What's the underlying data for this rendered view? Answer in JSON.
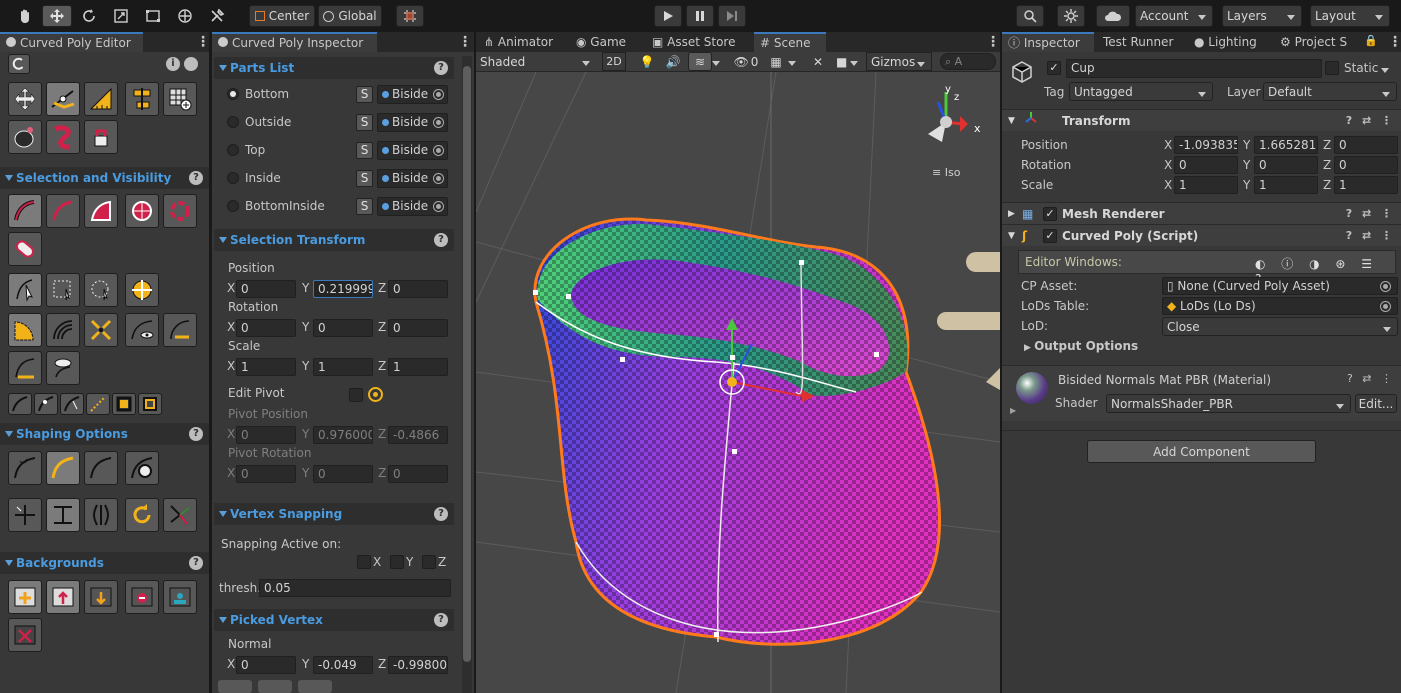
{
  "toolbar": {
    "pivot_mode": "Center",
    "pivot_rotation": "Global",
    "account": "Account",
    "layers": "Layers",
    "layout": "Layout"
  },
  "curved_poly_editor": {
    "tab_title": "Curved Poly Editor",
    "sections": {
      "selection": "Selection and Visibility",
      "shaping": "Shaping Options",
      "backgrounds": "Backgrounds"
    }
  },
  "inspector_panel": {
    "tab_title": "Curved Poly Inspector",
    "parts_list": {
      "title": "Parts List",
      "items": [
        {
          "name": "Bottom",
          "selected": true,
          "s": "S",
          "mode": "Biside"
        },
        {
          "name": "Outside",
          "selected": false,
          "s": "S",
          "mode": "Biside"
        },
        {
          "name": "Top",
          "selected": false,
          "s": "S",
          "mode": "Biside"
        },
        {
          "name": "Inside",
          "selected": false,
          "s": "S",
          "mode": "Biside"
        },
        {
          "name": "BottomInside",
          "selected": false,
          "s": "S",
          "mode": "Biside"
        }
      ]
    },
    "selection_transform": {
      "title": "Selection Transform",
      "position_label": "Position",
      "position": {
        "x": "0",
        "y": "0.219999",
        "z": "0"
      },
      "rotation_label": "Rotation",
      "rotation": {
        "x": "0",
        "y": "0",
        "z": "0"
      },
      "scale_label": "Scale",
      "scale": {
        "x": "1",
        "y": "1",
        "z": "1"
      },
      "edit_pivot_label": "Edit Pivot",
      "pivot_position_label": "Pivot Position",
      "pivot_position": {
        "x": "0",
        "y": "0.976000",
        "z": "-0.4866"
      },
      "pivot_rotation_label": "Pivot Rotation",
      "pivot_rotation": {
        "x": "0",
        "y": "0",
        "z": "0"
      }
    },
    "vertex_snapping": {
      "title": "Vertex Snapping",
      "active_label": "Snapping Active on:",
      "axes": [
        "X",
        "Y",
        "Z"
      ],
      "thresh_label": "thresh.",
      "thresh": "0.05"
    },
    "picked_vertex": {
      "title": "Picked Vertex",
      "normal_label": "Normal",
      "normal": {
        "x": "0",
        "y": "-0.049",
        "z": "-0.99800"
      }
    }
  },
  "scene_tabs": [
    "Animator",
    "Game",
    "Asset Store",
    "Scene"
  ],
  "scene_toolbar": {
    "shading": "Shaded",
    "mode_2d": "2D",
    "hidden_count": "0",
    "gizmos": "Gizmos",
    "search_placeholder": "A"
  },
  "scene": {
    "projection": "Iso",
    "axis_x": "x",
    "axis_y": "y",
    "axis_z": "z"
  },
  "inspector": {
    "tabs": [
      "Inspector",
      "Test Runner",
      "Lighting",
      "Project S"
    ],
    "object_name": "Cup",
    "static_label": "Static",
    "tag_label": "Tag",
    "tag": "Untagged",
    "layer_label": "Layer",
    "layer": "Default",
    "transform": {
      "title": "Transform",
      "position_label": "Position",
      "position": {
        "x": "-1.093835",
        "y": "1.665281",
        "z": "0"
      },
      "rotation_label": "Rotation",
      "rotation": {
        "x": "0",
        "y": "0",
        "z": "0"
      },
      "scale_label": "Scale",
      "scale": {
        "x": "1",
        "y": "1",
        "z": "1"
      }
    },
    "mesh_renderer": "Mesh Renderer",
    "curved_poly_script": {
      "title": "Curved Poly (Script)",
      "editor_windows": "Editor Windows:",
      "cp_asset_label": "CP Asset:",
      "cp_asset": "None (Curved Poly Asset)",
      "lods_table_label": "LoDs Table:",
      "lods_table": "LoDs (Lo Ds)",
      "lod_label": "LoD:",
      "lod": "Close",
      "output_options": "Output Options"
    },
    "material": {
      "title": "Bisided Normals Mat PBR (Material)",
      "shader_label": "Shader",
      "shader": "NormalsShader_PBR",
      "edit": "Edit..."
    },
    "add_component": "Add Component"
  },
  "axis_letters": {
    "x": "X",
    "y": "Y",
    "z": "Z"
  },
  "colors": {
    "accent": "#3a79bb",
    "section_title": "#4a9be0",
    "panel_bg": "#383838",
    "selection_outline": "#ff7a1a"
  }
}
